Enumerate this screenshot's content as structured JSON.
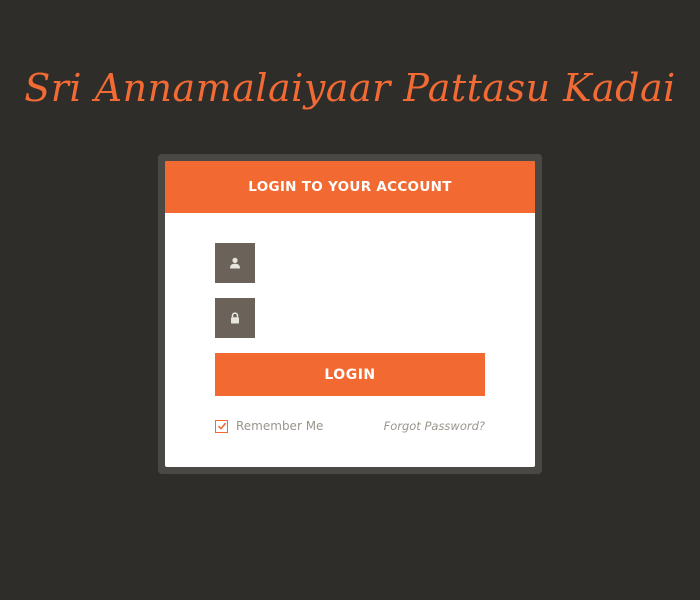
{
  "site": {
    "title": "Sri Annamalaiyaar Pattasu Kadai"
  },
  "login_form": {
    "header": "LOGIN TO YOUR ACCOUNT",
    "username": {
      "icon": "user-icon",
      "value": "",
      "placeholder": ""
    },
    "password": {
      "icon": "lock-icon",
      "value": "",
      "placeholder": ""
    },
    "login_label": "LOGIN",
    "remember_me": {
      "label": "Remember Me",
      "checked": true
    },
    "forgot_password_label": "Forgot Password?"
  },
  "colors": {
    "background": "#2f2d29",
    "accent": "#f26a31",
    "icon_box": "#6b6359",
    "muted_text": "#9b958d"
  }
}
